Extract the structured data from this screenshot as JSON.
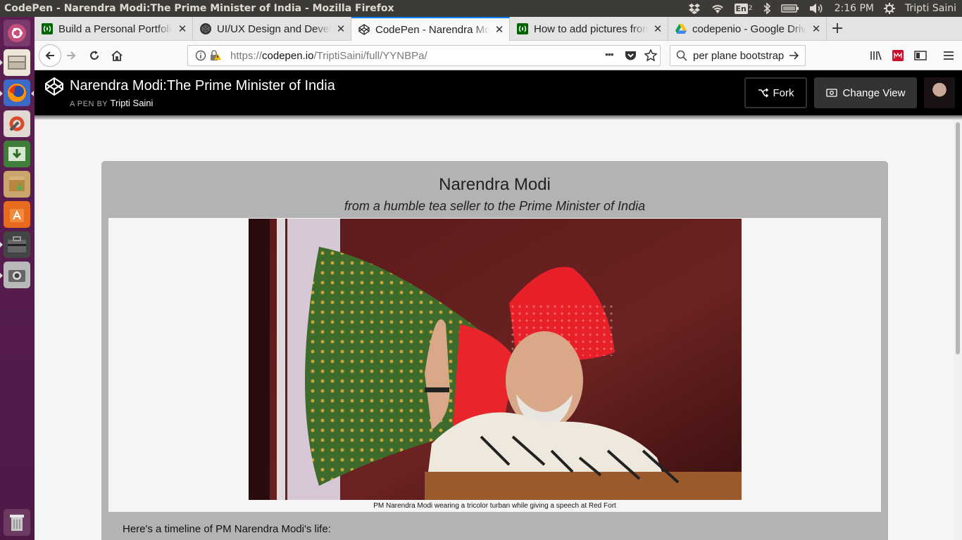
{
  "os": {
    "window_title": "CodePen - Narendra Modi:The Prime Minister of India - Mozilla Firefox",
    "keyboard_layout": "En",
    "keyboard_sub": "2",
    "clock": "2:16 PM",
    "user": "Tripti Saini"
  },
  "launcher": {
    "items": [
      "ubuntu-dash",
      "files",
      "firefox",
      "system-settings",
      "software-updater",
      "archive-manager",
      "software-center",
      "toolbox",
      "screenshot",
      "trash"
    ]
  },
  "tabs": [
    {
      "label": "Build a Personal Portfolio",
      "favicon": "freecodecamp",
      "active": false
    },
    {
      "label": "UI/UX Design and Development",
      "favicon": "codepen-dark",
      "active": false
    },
    {
      "label": "CodePen - Narendra Modi",
      "favicon": "codepen",
      "active": true
    },
    {
      "label": "How to add pictures from",
      "favicon": "freecodecamp",
      "active": false
    },
    {
      "label": "codepenio - Google Drive",
      "favicon": "google-drive",
      "active": false
    }
  ],
  "navbar": {
    "url_scheme": "https://",
    "url_host": "codepen.io",
    "url_path": "/TriptiSaini/full/YYNBPa/",
    "search_text": "per plane bootstrap",
    "page_actions": "•••"
  },
  "codepen": {
    "pen_title": "Narendra Modi:The Prime Minister of India",
    "by_prefix": "A PEN BY",
    "author": "Tripti Saini",
    "fork_label": "Fork",
    "change_view_label": "Change View"
  },
  "content": {
    "heading": "Narendra Modi",
    "subtitle": "from a humble tea seller to the Prime Minister of India",
    "caption": "PM Narendra Modi wearing a tricolor turban while giving a speech at Red Fort",
    "timeline_intro": "Here's a timeline of PM Narendra Modi's life:"
  },
  "colors": {
    "launcher": "#5b1d4f",
    "tab_accent": "#0a84ff",
    "codepen_header": "#000000",
    "card": "#b3b3b3"
  }
}
